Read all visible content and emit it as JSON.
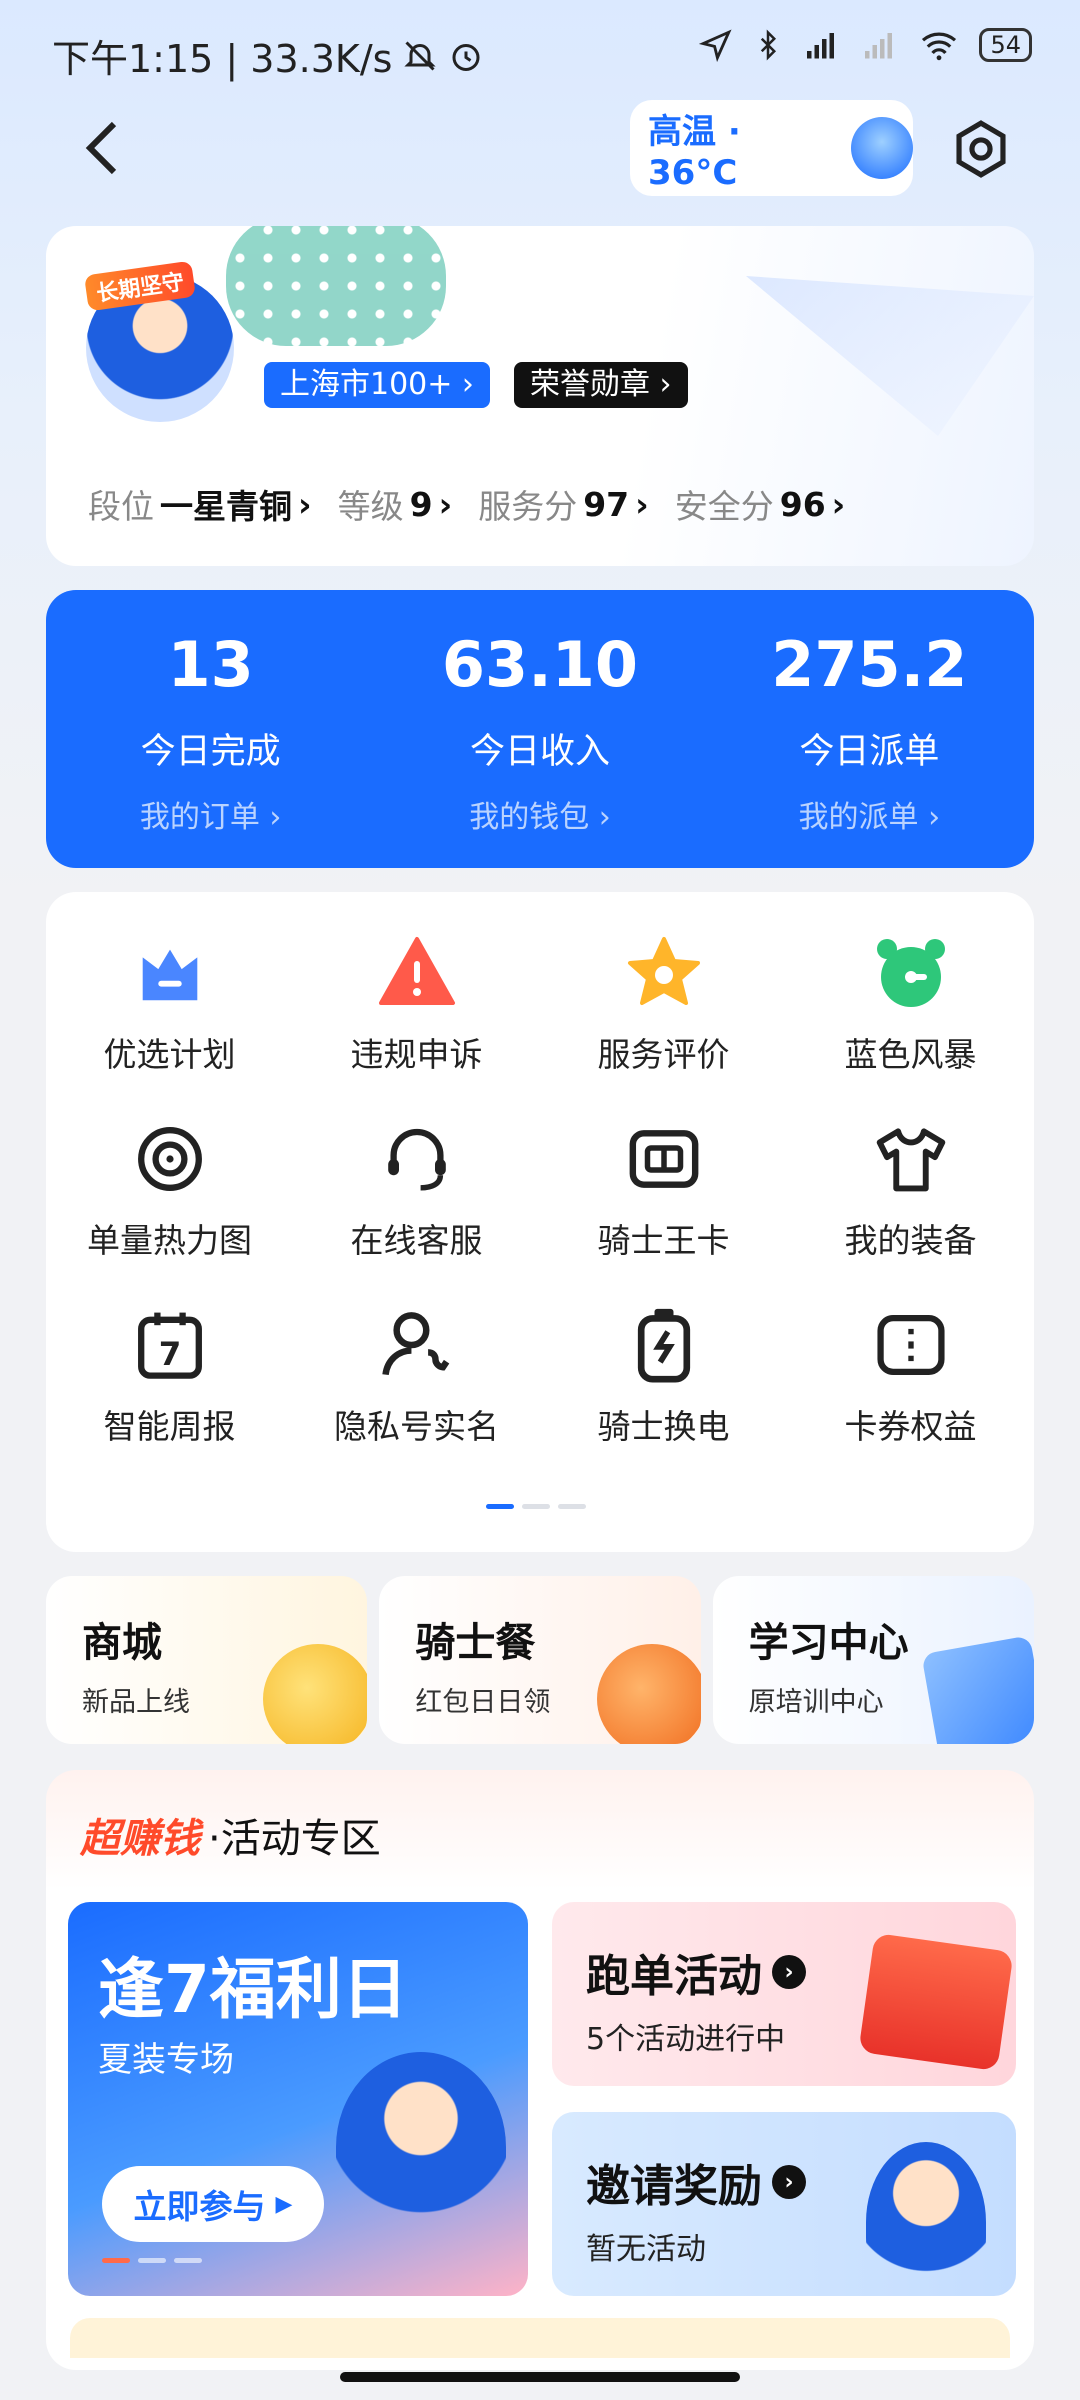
{
  "status_bar": {
    "time": "下午1:15 | 33.3K/s",
    "battery": "54"
  },
  "header": {
    "weather": "高温 · 36°C"
  },
  "profile": {
    "badge": "长期坚守",
    "city_tag": "上海市100+ ›",
    "medal_tag": "荣誉勋章 ›",
    "stats": [
      {
        "key": "段位",
        "value": "一星青铜"
      },
      {
        "key": "等级",
        "value": "9"
      },
      {
        "key": "服务分",
        "value": "97"
      },
      {
        "key": "安全分",
        "value": "96"
      }
    ]
  },
  "summary": [
    {
      "num": "13",
      "label": "今日完成",
      "link": "我的订单 ›"
    },
    {
      "num": "63.10",
      "label": "今日收入",
      "link": "我的钱包 ›"
    },
    {
      "num": "275.2",
      "label": "今日派单",
      "link": "我的派单 ›"
    }
  ],
  "grid": [
    {
      "label": "优选计划",
      "icon": "crown-icon"
    },
    {
      "label": "违规申诉",
      "icon": "warning-icon"
    },
    {
      "label": "服务评价",
      "icon": "star-icon"
    },
    {
      "label": "蓝色风暴",
      "icon": "alarm-icon"
    },
    {
      "label": "单量热力图",
      "icon": "target-icon"
    },
    {
      "label": "在线客服",
      "icon": "headset-icon"
    },
    {
      "label": "骑士王卡",
      "icon": "sim-card-icon"
    },
    {
      "label": "我的装备",
      "icon": "tshirt-icon"
    },
    {
      "label": "智能周报",
      "icon": "calendar-icon"
    },
    {
      "label": "隐私号实名",
      "icon": "user-phone-icon"
    },
    {
      "label": "骑士换电",
      "icon": "battery-swap-icon"
    },
    {
      "label": "卡券权益",
      "icon": "coupon-icon"
    }
  ],
  "mini_cards": [
    {
      "title": "商城",
      "sub": "新品上线"
    },
    {
      "title": "骑士餐",
      "sub": "红包日日领"
    },
    {
      "title": "学习中心",
      "sub": "原培训中心"
    }
  ],
  "activity": {
    "brand": "超赚钱",
    "section": "·活动专区",
    "promo_title": "逢7福利日",
    "promo_sub": "夏装专场",
    "promo_btn": "立即参与",
    "run_title": "跑单活动",
    "run_sub": "5个活动进行中",
    "invite_title": "邀请奖励",
    "invite_sub": "暂无活动"
  },
  "colors": {
    "accent": "#1a6cff",
    "brand_red": "#ff4a2a"
  }
}
